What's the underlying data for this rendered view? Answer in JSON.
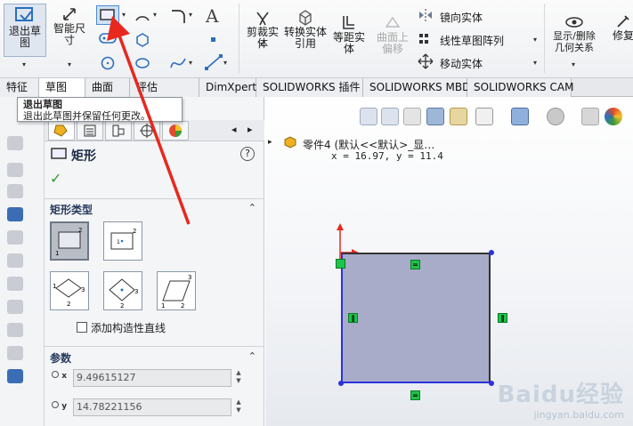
{
  "ribbon": {
    "exit_sketch": "退出草图",
    "smart_dimension": "智能尺寸",
    "trim": "剪裁实体",
    "convert": "转换实体引用",
    "offset": "等距实体",
    "surface_offset": "曲面上偏移",
    "mirror": "镜向实体",
    "linear_pattern": "线性草图阵列",
    "move": "移动实体",
    "show_delete": "显示/删除几何关系",
    "repair": "修复",
    "text_icon": "A",
    "dropdown": "▾"
  },
  "tabs": [
    {
      "label": "特征"
    },
    {
      "label": "草图"
    },
    {
      "label": "曲面"
    },
    {
      "label": "评估"
    },
    {
      "label": "DimXpert"
    },
    {
      "label": "SOLIDWORKS 插件"
    },
    {
      "label": "SOLIDWORKS MBD"
    },
    {
      "label": "SOLIDWORKS CAM"
    }
  ],
  "tooltip": {
    "title": "退出草图",
    "desc": "退出此草图并保留任何更改。"
  },
  "pm": {
    "title": "矩形",
    "help": "?",
    "ok": "✓",
    "rect_type_header": "矩形类型",
    "construction_checkbox": "添加构造性直线",
    "params_header": "参数",
    "x_label": "x",
    "y_label": "y",
    "x_value": "9.49615127",
    "y_value": "14.78221156",
    "collapse": "⌃",
    "tab_prev": "◂",
    "tab_next": "▸"
  },
  "viewport": {
    "tree_item": "零件4 (默认<<默认>_显…",
    "coords": "x = 16.97, y = 11.4",
    "expand": "▸"
  },
  "relations": {
    "horizontal": "=",
    "vertical": "‖"
  },
  "watermark": {
    "brand": "Baidu经验",
    "url": "jingyan.baidu.com"
  },
  "colors": {
    "accent": "#2a32d8",
    "relation": "#1fc34a",
    "arrow": "#e8281e",
    "rect_fill": "#a9acc8"
  }
}
